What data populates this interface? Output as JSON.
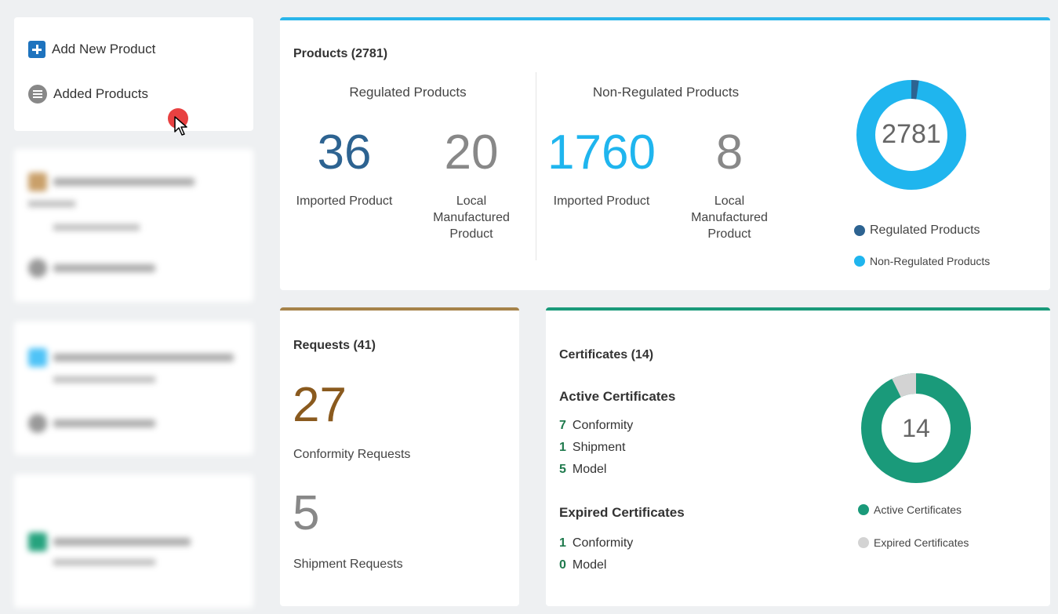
{
  "sidebar": {
    "add_new_product": "Add New Product",
    "added_products": "Added Products"
  },
  "products": {
    "title": "Products (2781)",
    "regulated_label": "Regulated Products",
    "non_regulated_label": "Non-Regulated Products",
    "regulated_imported": "36",
    "regulated_local": "20",
    "non_regulated_imported": "1760",
    "non_regulated_local": "8",
    "imported_label": "Imported Product",
    "local_label": "Local Manufactured Product",
    "total": "2781",
    "legend_regulated": "Regulated Products",
    "legend_non_regulated": "Non-Regulated Products",
    "colors": {
      "regulated": "#2d6391",
      "non_regulated": "#1fb5ee"
    }
  },
  "requests": {
    "title": "Requests (41)",
    "conformity_count": "27",
    "conformity_label": "Conformity Requests",
    "shipment_count": "5",
    "shipment_label": "Shipment Requests"
  },
  "certificates": {
    "title": "Certificates (14)",
    "active_heading": "Active Certificates",
    "active": [
      {
        "count": "7",
        "label": "Conformity"
      },
      {
        "count": "1",
        "label": "Shipment"
      },
      {
        "count": "5",
        "label": "Model"
      }
    ],
    "expired_heading": "Expired Certificates",
    "expired": [
      {
        "count": "1",
        "label": "Conformity"
      },
      {
        "count": "0",
        "label": "Model"
      }
    ],
    "total": "14",
    "legend_active": "Active Certificates",
    "legend_expired": "Expired Certificates",
    "colors": {
      "active": "#1a9a7a",
      "expired": "#d3d3d3"
    }
  }
}
